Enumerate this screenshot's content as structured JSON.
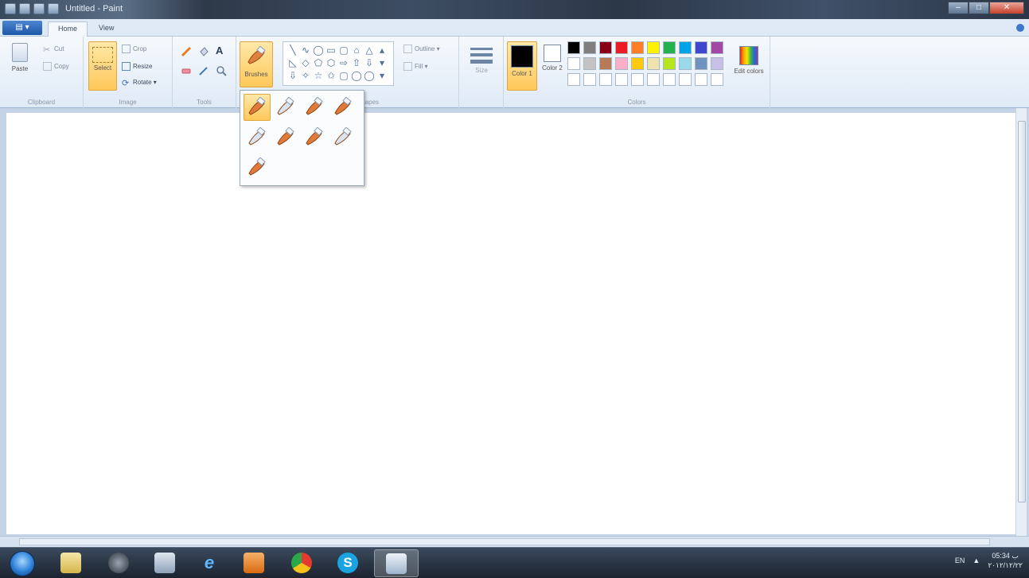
{
  "window": {
    "title": "Untitled - Paint",
    "controls": {
      "minimize": "–",
      "maximize": "□",
      "close": "✕"
    }
  },
  "tabs": {
    "app_menu": "▤ ▾",
    "home": "Home",
    "view": "View"
  },
  "ribbon": {
    "clipboard": {
      "label": "Clipboard",
      "paste": "Paste",
      "cut": "Cut",
      "copy": "Copy"
    },
    "image": {
      "label": "Image",
      "select": "Select",
      "crop": "Crop",
      "resize": "Resize",
      "rotate": "Rotate ▾"
    },
    "tools": {
      "label": "Tools"
    },
    "brushes": {
      "label": "Brushes"
    },
    "shapes": {
      "label": "Shapes",
      "glyphs": [
        "╲",
        "∿",
        "◯",
        "▭",
        "▢",
        "⌂",
        "△",
        "▴",
        "◺",
        "◇",
        "⬠",
        "⬡",
        "⇨",
        "⇧",
        "⇩",
        "▾",
        "⇩",
        "✧",
        "☆",
        "✩",
        "▢",
        "◯",
        "◯",
        "▾"
      ],
      "outline": "Outline ▾",
      "fill": "Fill ▾"
    },
    "size": {
      "label": "Size"
    },
    "colors": {
      "label": "Colors",
      "color1": "Color 1",
      "color2": "Color 2",
      "edit_colors": "Edit colors",
      "palette": [
        "#000000",
        "#7f7f7f",
        "#880015",
        "#ed1c24",
        "#ff7f27",
        "#fff200",
        "#22b14c",
        "#00a2e8",
        "#3f48cc",
        "#a349a4",
        "#ffffff",
        "#c3c3c3",
        "#b97a57",
        "#ffaec9",
        "#ffc90e",
        "#efe4b0",
        "#b5e61d",
        "#99d9ea",
        "#7092be",
        "#c8bfe7",
        "#ffffff",
        "#ffffff",
        "#ffffff",
        "#ffffff",
        "#ffffff",
        "#ffffff",
        "#ffffff",
        "#ffffff",
        "#ffffff",
        "#ffffff"
      ],
      "accent_selected": "#ffc85a"
    }
  },
  "brushes_dropdown": {
    "items": [
      "brush",
      "calligraphy-brush-1",
      "calligraphy-brush-2",
      "airbrush",
      "oil-brush",
      "crayon",
      "marker",
      "natural-pencil",
      "watercolor-brush"
    ]
  },
  "taskbar": {
    "language": "EN",
    "tray_arrow": "▲",
    "time": "05:34 ب",
    "date": "٢٠١٢/١٢/٢٢"
  }
}
